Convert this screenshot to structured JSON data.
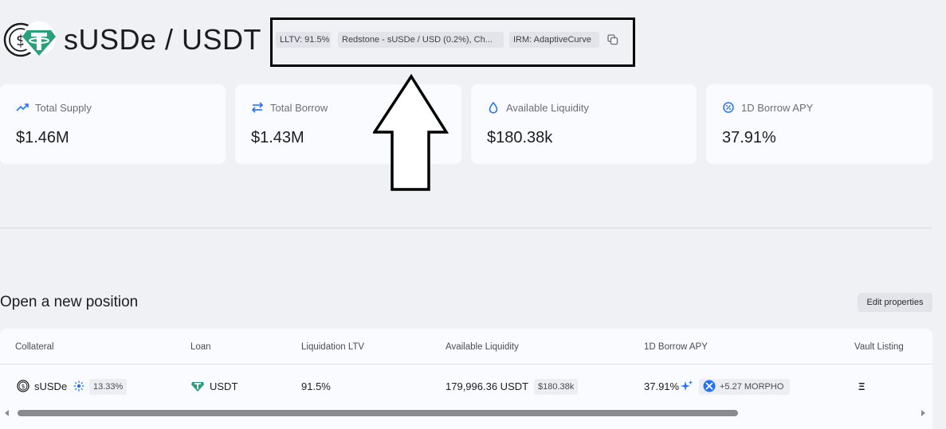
{
  "header": {
    "pair_title": "sUSDe / USDT",
    "tags": {
      "lltv": "LLTV: 91.5%",
      "oracle": "Redstone - sUSDe / USD (0.2%), Ch...",
      "irm": "IRM: AdaptiveCurve"
    }
  },
  "stats": [
    {
      "label": "Total Supply",
      "value": "$1.46M",
      "icon": "trend-up-icon"
    },
    {
      "label": "Total Borrow",
      "value": "$1.43M",
      "icon": "swap-arrows-icon"
    },
    {
      "label": "Available Liquidity",
      "value": "$180.38k",
      "icon": "droplet-icon"
    },
    {
      "label": "1D Borrow APY",
      "value": "37.91%",
      "icon": "percent-badge-icon"
    }
  ],
  "section": {
    "title": "Open a new position",
    "edit_label": "Edit properties"
  },
  "table": {
    "headers": [
      "Collateral",
      "Loan",
      "Liquidation LTV",
      "Available Liquidity",
      "1D Borrow APY",
      "Vault Listing"
    ],
    "row": {
      "collateral": "sUSDe",
      "collateral_yield": "13.33%",
      "loan": "USDT",
      "lltv": "91.5%",
      "liquidity": "179,996.36 USDT",
      "liquidity_usd": "$180.38k",
      "apy": "37.91%",
      "reward": "+5.27 MORPHO",
      "vault_listing": "Ξ"
    }
  },
  "colors": {
    "background": "#f0f1f5",
    "card": "#fafbfe",
    "accent": "#2470ff",
    "tether": "#26a17b"
  }
}
